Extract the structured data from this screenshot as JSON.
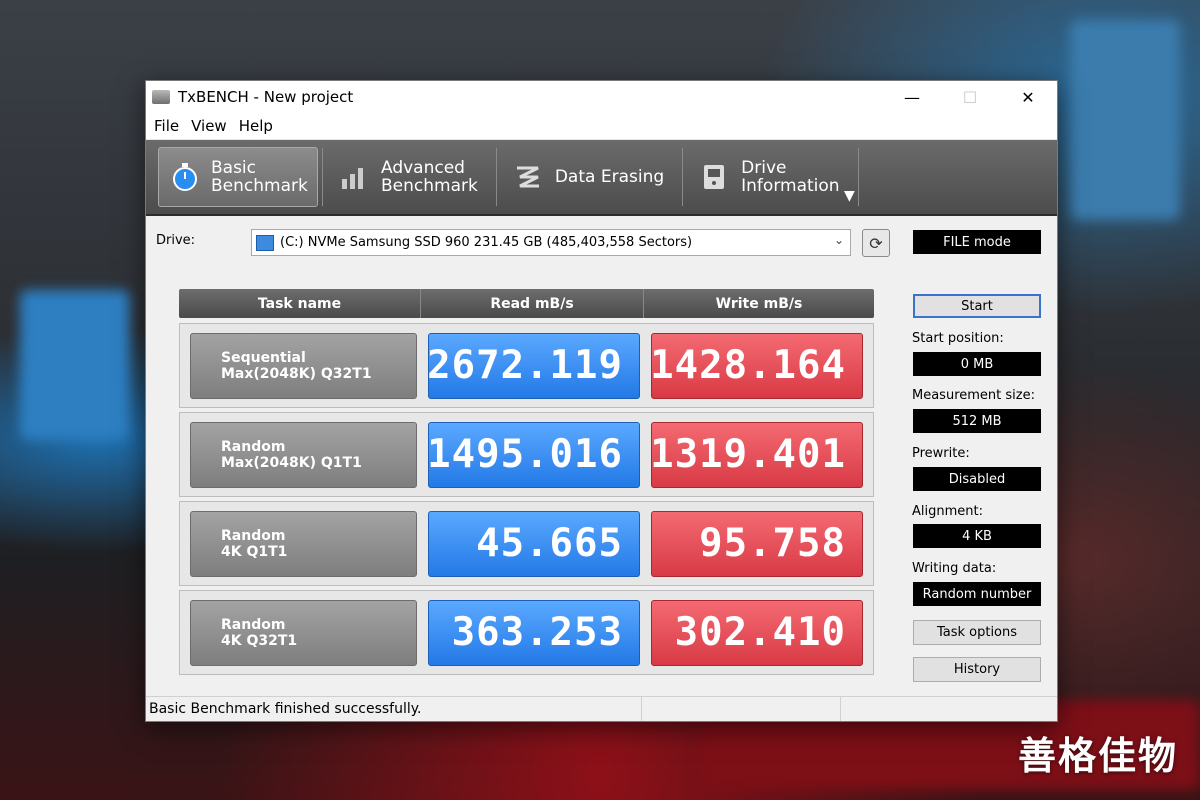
{
  "window": {
    "title": "TxBENCH - New project"
  },
  "menu": [
    "File",
    "View",
    "Help"
  ],
  "toolbar": {
    "tabs": [
      {
        "line1": "Basic",
        "line2": "Benchmark",
        "icon": "stopwatch-icon"
      },
      {
        "line1": "Advanced",
        "line2": "Benchmark",
        "icon": "bar-chart-icon"
      },
      {
        "line1": "Data Erasing",
        "line2": "",
        "icon": "eraser-icon"
      },
      {
        "line1": "Drive",
        "line2": "Information",
        "icon": "drive-info-icon"
      }
    ],
    "more": "▼"
  },
  "drive": {
    "label": "Drive:",
    "value": "(C:) NVMe Samsung SSD 960  231.45 GB (485,403,558 Sectors)"
  },
  "mode": "FILE mode",
  "table": {
    "headers": [
      "Task name",
      "Read mB/s",
      "Write mB/s"
    ],
    "rows": [
      {
        "task1": "Sequential",
        "task2": "Max(2048K) Q32T1",
        "read": "2672.119",
        "write": "1428.164"
      },
      {
        "task1": "Random",
        "task2": "Max(2048K) Q1T1",
        "read": "1495.016",
        "write": "1319.401"
      },
      {
        "task1": "Random",
        "task2": "4K Q1T1",
        "read": "45.665",
        "write": "95.758"
      },
      {
        "task1": "Random",
        "task2": "4K Q32T1",
        "read": "363.253",
        "write": "302.410"
      }
    ]
  },
  "panel": {
    "start": "Start",
    "start_position_label": "Start position:",
    "start_position": "0 MB",
    "measurement_size_label": "Measurement size:",
    "measurement_size": "512 MB",
    "prewrite_label": "Prewrite:",
    "prewrite": "Disabled",
    "alignment_label": "Alignment:",
    "alignment": "4 KB",
    "writing_data_label": "Writing data:",
    "writing_data": "Random number",
    "task_options": "Task options",
    "history": "History"
  },
  "status": "Basic Benchmark finished successfully.",
  "watermark": "善格佳物",
  "colors": {
    "read": "#2d84f0",
    "write": "#e0474f",
    "toolbar": "#5a5a5a"
  }
}
